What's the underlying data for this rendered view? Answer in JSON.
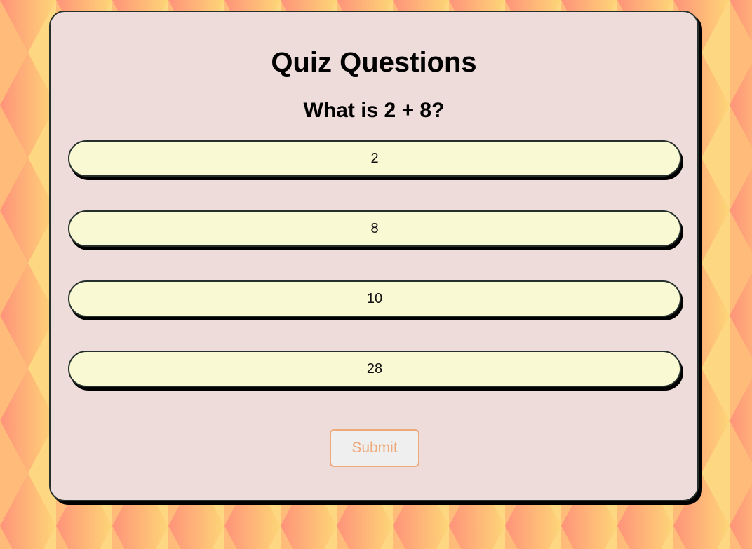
{
  "quiz": {
    "title": "Quiz Questions",
    "question": "What is 2 + 8?",
    "options": [
      {
        "label": "2"
      },
      {
        "label": "8"
      },
      {
        "label": "10"
      },
      {
        "label": "28"
      }
    ],
    "submit_label": "Submit",
    "submit_disabled": true
  },
  "colors": {
    "card_background": "#eedcdb",
    "option_background": "#f9f9d3",
    "submit_accent": "#eea97c",
    "background_warm_yellow": "#fdd877",
    "background_coral": "#ff8d7a"
  }
}
